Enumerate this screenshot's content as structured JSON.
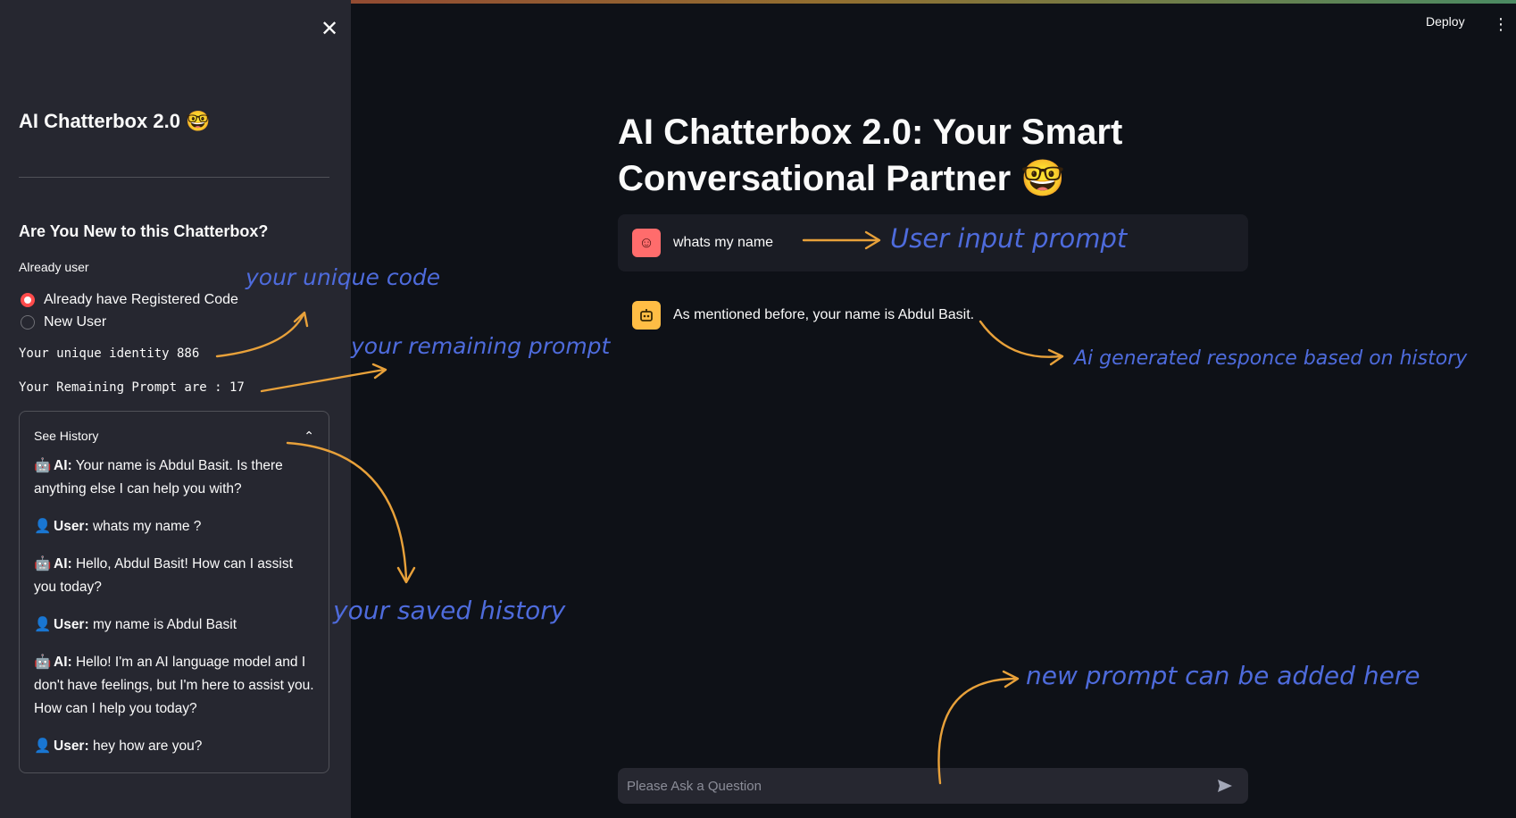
{
  "sidebar": {
    "close_icon": "close-icon",
    "title": "AI Chatterbox 2.0 🤓",
    "subtitle": "Are You New to this Chatterbox?",
    "radio_group_label": "Already user",
    "options": [
      "Already have Registered Code",
      "New User"
    ],
    "selected_option": "Already have Registered Code",
    "identity_text": "Your unique identity 886",
    "remaining_text": "Your Remaining Prompt are : 17",
    "history": {
      "label": "See History",
      "expanded": true,
      "items": [
        {
          "icon": "🤖",
          "who": "AI:",
          "text": "Your name is Abdul Basit. Is there anything else I can help you with?"
        },
        {
          "icon": "👤",
          "who": "User:",
          "text": "whats my name ?"
        },
        {
          "icon": "🤖",
          "who": "AI:",
          "text": "Hello, Abdul Basit! How can I assist you today?"
        },
        {
          "icon": "👤",
          "who": "User:",
          "text": "my name is Abdul Basit"
        },
        {
          "icon": "🤖",
          "who": "AI:",
          "text": "Hello! I'm an AI language model and I don't have feelings, but I'm here to assist you. How can I help you today?"
        },
        {
          "icon": "👤",
          "who": "User:",
          "text": "hey how are you?"
        }
      ]
    }
  },
  "header": {
    "deploy_label": "Deploy",
    "menu_icon": "kebab-menu-icon"
  },
  "main": {
    "title": "AI Chatterbox 2.0: Your Smart Conversational Partner 🤓",
    "messages": [
      {
        "role": "user",
        "avatar_icon": "user-face-icon",
        "text": "whats my name"
      },
      {
        "role": "assistant",
        "avatar_icon": "robot-icon",
        "text": "As mentioned before, your name is Abdul Basit."
      }
    ],
    "chat_input": {
      "placeholder": "Please Ask a Question",
      "send_icon": "send-icon"
    }
  },
  "annotations": {
    "user_input": "User input prompt",
    "unique_code": "your unique code",
    "remaining_prompt": "your remaining prompt",
    "ai_response": "Ai generated responce based on history",
    "saved_history": "your saved history",
    "new_prompt": "new prompt can be added here",
    "color": "#4e6bdc",
    "arrow_color": "#e8a13a"
  },
  "theme": {
    "background": "#0e1117",
    "sidebar_bg": "#262730",
    "accent": "#ff4b4b",
    "text": "#fafafa"
  }
}
